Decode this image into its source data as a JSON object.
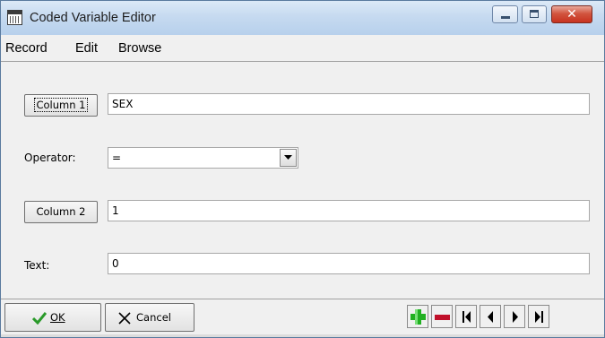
{
  "window": {
    "title": "Coded Variable Editor",
    "close_glyph": "✕"
  },
  "menu": [
    "Record",
    "Edit",
    "Browse"
  ],
  "form": {
    "column1_button": "Column 1",
    "column1_value": "SEX",
    "operator_label": "Operator:",
    "operator_value": "=",
    "column2_button": "Column 2",
    "column2_value": "1",
    "text_label": "Text:",
    "text_value": "0"
  },
  "footer": {
    "ok_label": "OK",
    "cancel_label": "Cancel"
  },
  "icons": {
    "app": "grid-window-icon",
    "ok": "check-icon",
    "cancel": "x-icon",
    "add": "plus-icon",
    "delete": "minus-icon",
    "first": "first-record-icon",
    "prev": "prev-record-icon",
    "next": "next-record-icon",
    "last": "last-record-icon"
  },
  "colors": {
    "add": "#22b022",
    "delete": "#c0102a",
    "close": "#c7321f",
    "check": "#2a9a2a"
  }
}
